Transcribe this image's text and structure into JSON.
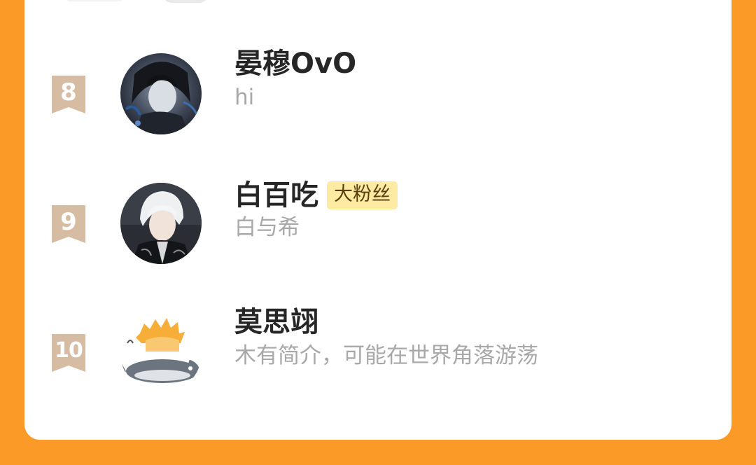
{
  "users": [
    {
      "rank": "8",
      "name": "晏穆OvO",
      "badge": "",
      "bio": "hi",
      "avatar_icon": "dark-haired-anime-avatar"
    },
    {
      "rank": "9",
      "name": "白百吃",
      "badge": "大粉丝",
      "bio": "白与希",
      "avatar_icon": "white-haired-anime-avatar"
    },
    {
      "rank": "10",
      "name": "莫思翊",
      "badge": "",
      "bio": "木有简介，可能在世界角落游荡",
      "avatar_icon": "orange-haired-shark-avatar"
    }
  ],
  "colors": {
    "background": "#fb9a27",
    "card": "#ffffff",
    "rank_ribbon": "#d5bca2",
    "badge_bg": "#fdeaa3",
    "name": "#262626",
    "bio": "#a8a8a8"
  }
}
